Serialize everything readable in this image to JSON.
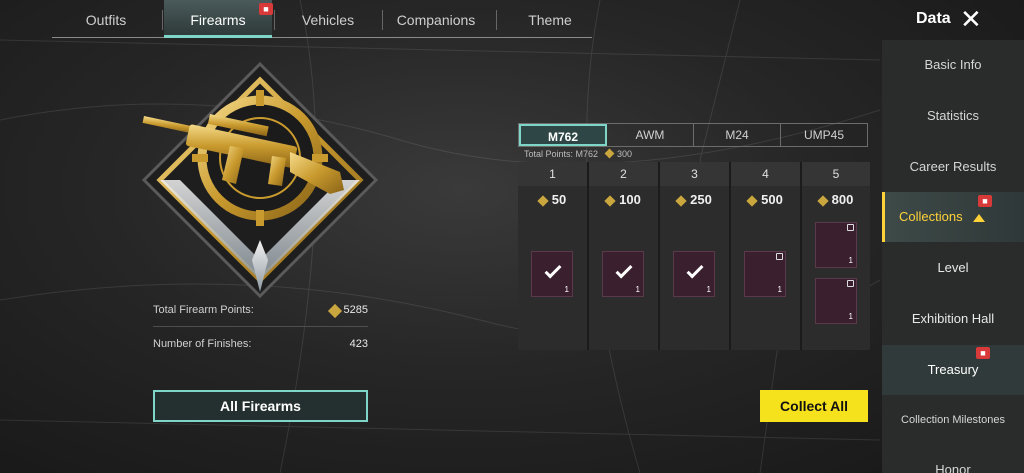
{
  "top_tabs": [
    "Outfits",
    "Firearms",
    "Vehicles",
    "Companions",
    "Theme"
  ],
  "active_top_tab": "Firearms",
  "header": {
    "title": "Data"
  },
  "sidebar": {
    "items": [
      {
        "label": "Basic Info"
      },
      {
        "label": "Statistics"
      },
      {
        "label": "Career Results"
      },
      {
        "label": "Collections"
      },
      {
        "label": "Level"
      },
      {
        "label": "Exhibition Hall"
      },
      {
        "label": "Treasury"
      },
      {
        "label": "Collection Milestones"
      },
      {
        "label": "Honor"
      }
    ]
  },
  "stats": {
    "total_points_label": "Total Firearm Points:",
    "total_points_value": "5285",
    "finishes_label": "Number of Finishes:",
    "finishes_value": "423"
  },
  "buttons": {
    "all_firearms": "All Firearms",
    "collect_all": "Collect All"
  },
  "weapon_tabs": [
    "M762",
    "AWM",
    "M24",
    "UMP45"
  ],
  "active_weapon_tab": "M762",
  "total_points_line": {
    "label": "Total Points: M762",
    "value": "300"
  },
  "tiers": [
    {
      "num": "1",
      "points": "50",
      "rewards": [
        {
          "qty": "1",
          "claimed": true,
          "locked": false
        }
      ]
    },
    {
      "num": "2",
      "points": "100",
      "rewards": [
        {
          "qty": "1",
          "claimed": true,
          "locked": false
        }
      ]
    },
    {
      "num": "3",
      "points": "250",
      "rewards": [
        {
          "qty": "1",
          "claimed": true,
          "locked": false
        }
      ]
    },
    {
      "num": "4",
      "points": "500",
      "rewards": [
        {
          "qty": "1",
          "claimed": false,
          "locked": true
        }
      ]
    },
    {
      "num": "5",
      "points": "800",
      "rewards": [
        {
          "qty": "1",
          "claimed": false,
          "locked": true
        },
        {
          "qty": "1",
          "claimed": false,
          "locked": true
        }
      ]
    }
  ],
  "colors": {
    "accent": "#7fd6c8",
    "highlight": "#ffd23a",
    "gold": "#c9a63e",
    "collect_button": "#f5e21d"
  }
}
